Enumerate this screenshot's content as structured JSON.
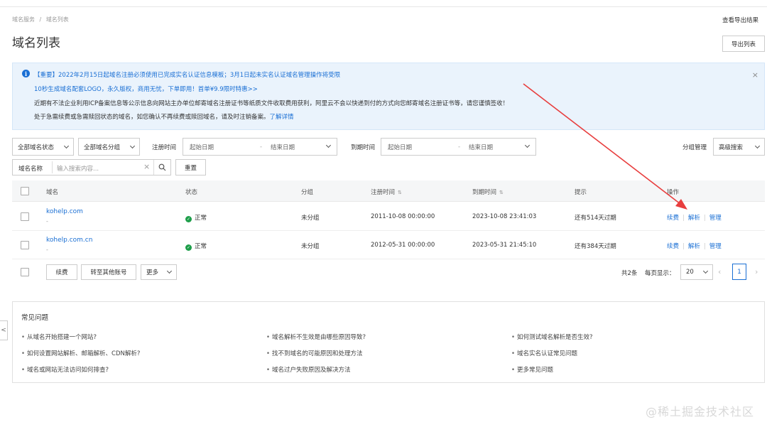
{
  "breadcrumb": [
    "域名服务",
    "/",
    "域名列表"
  ],
  "top_link": "查看导出结果",
  "page_title": "域名列表",
  "export_button": "导出列表",
  "notice": {
    "icon": "info-icon",
    "line1": "【重要】2022年2月15日起域名注册必须使用已完成实名认证信息模板；3月1日起未实名认证域名管理操作将受限",
    "line2": "10秒生成域名配套LOGO，永久版权，商用无忧，下单即用！首单¥9.9限时特惠>>",
    "line3": "近期有不法企业利用ICP备案信息等公示信息向网站主办单位邮寄域名注册证书等纸质文件收取费用获利，阿里云不会以快递到付的方式向您邮寄域名注册证书等，请您谨慎签收！",
    "line4": "处于急需续费或急需赎回状态的域名，如您确认不再续费或赎回域名，请及时注销备案。",
    "line4_link": "了解详情",
    "close": "×"
  },
  "filters": {
    "status": "全部域名状态",
    "group": "全部域名分组",
    "reg_time_label": "注册时间",
    "reg_start": "起始日期",
    "reg_dash": "-",
    "reg_end": "结束日期",
    "exp_time_label": "到期时间",
    "exp_start": "起始日期",
    "exp_dash": "-",
    "exp_end": "结束日期",
    "group_manage": "分组管理",
    "advanced_search": "高级搜索",
    "name_label": "域名名称",
    "search_placeholder": "输入搜索内容...",
    "clear": "×",
    "reset": "重置"
  },
  "table": {
    "headers": [
      "域名",
      "状态",
      "分组",
      "注册时间",
      "到期时间",
      "提示",
      "操作"
    ],
    "sort_glyph": "⇅",
    "rows": [
      {
        "domain": "kohelp.com",
        "sub": "-",
        "status": "正常",
        "group": "未分组",
        "reg": "2011-10-08 00:00:00",
        "exp": "2023-10-08 23:41:03",
        "hint": "还有514天过期",
        "ops": [
          "续费",
          "解析",
          "管理"
        ]
      },
      {
        "domain": "kohelp.com.cn",
        "sub": "-",
        "status": "正常",
        "group": "未分组",
        "reg": "2012-05-31 00:00:00",
        "exp": "2023-05-31 21:45:10",
        "hint": "还有384天过期",
        "ops": [
          "续费",
          "解析",
          "管理"
        ]
      }
    ]
  },
  "footer_actions": {
    "renew": "续费",
    "transfer": "转至其他账号",
    "more": "更多",
    "total": "共2条",
    "per_page_label": "每页显示：",
    "per_page": "20",
    "page": "1"
  },
  "faq": {
    "title": "常见问题",
    "items": [
      "从域名开始搭建一个网站?",
      "域名解析不生效是由哪些原因导致?",
      "如何测试域名解析是否生效?",
      "如何设置网站解析、邮箱解析、CDN解析?",
      "找不到域名的可能原因和处理方法",
      "域名实名认证常见问题",
      "域名或网站无法访问如何排查?",
      "域名过户失败原因及解决方法",
      "更多常见问题"
    ]
  },
  "side_tab": "<",
  "watermark": "@稀土掘金技术社区",
  "colors": {
    "accent": "#1a6fd4",
    "success": "#1e9e4a",
    "arrow": "#e83e3e",
    "notice_bg": "#eaf3fc"
  }
}
